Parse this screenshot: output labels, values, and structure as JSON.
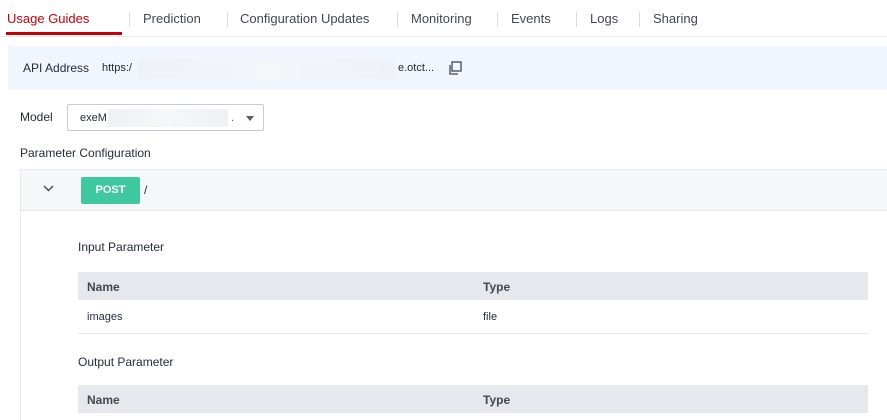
{
  "tabs": [
    {
      "label": "Usage Guides",
      "active": true
    },
    {
      "label": "Prediction"
    },
    {
      "label": "Configuration Updates"
    },
    {
      "label": "Monitoring"
    },
    {
      "label": "Events"
    },
    {
      "label": "Logs"
    },
    {
      "label": "Sharing"
    }
  ],
  "api": {
    "label": "API Address",
    "url_prefix": "https:/",
    "url_suffix": "e.otct...",
    "copy_icon": "copy-icon"
  },
  "model": {
    "label": "Model",
    "value_prefix": "exeM",
    "value_suffix": "."
  },
  "parameter_configuration": "Parameter Configuration",
  "endpoint": {
    "method": "POST",
    "path": "/"
  },
  "input": {
    "title": "Input Parameter",
    "columns": [
      "Name",
      "Type"
    ],
    "rows": [
      [
        "images",
        "file"
      ]
    ]
  },
  "output": {
    "title": "Output Parameter",
    "columns": [
      "Name",
      "Type"
    ]
  },
  "colors": {
    "accent": "#c7000b",
    "post_badge": "#3fc9a0",
    "api_bar_bg": "#f1f5fd"
  }
}
